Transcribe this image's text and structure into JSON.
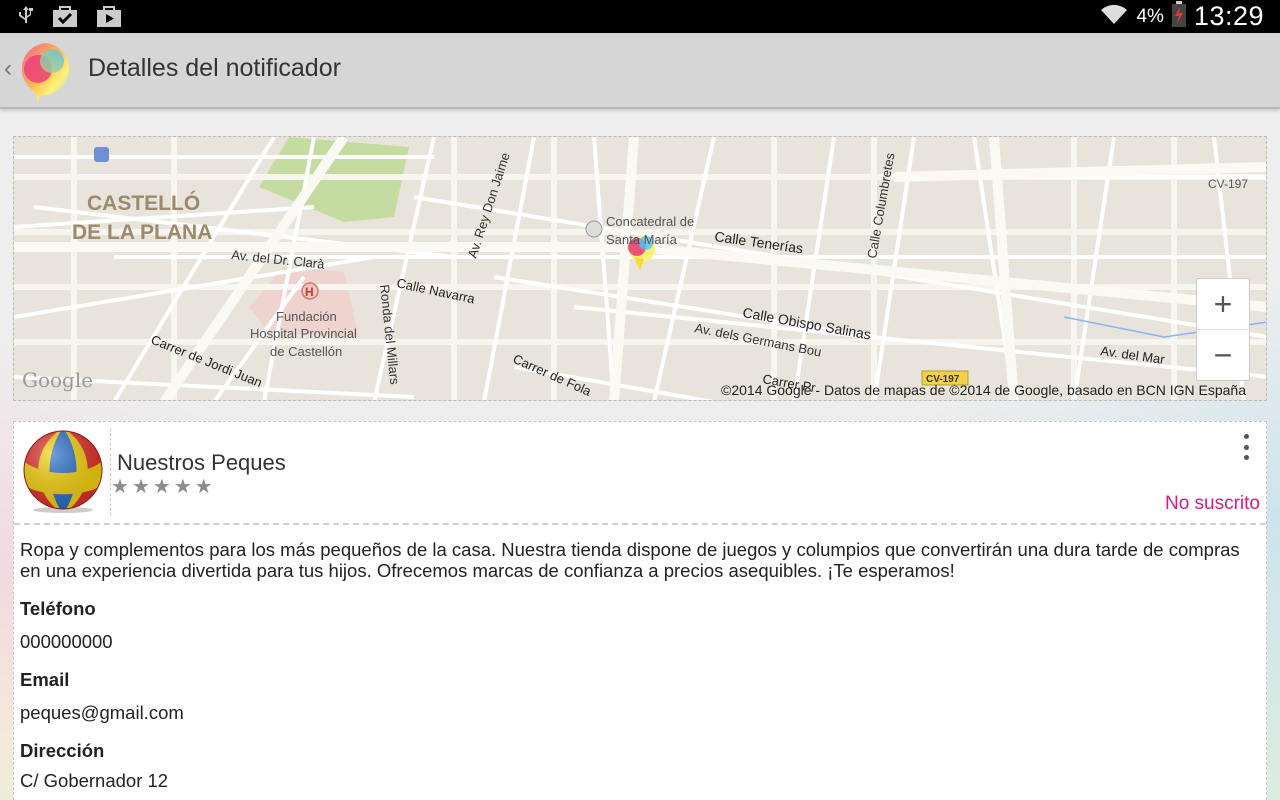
{
  "status_bar": {
    "battery_pct": "4%",
    "time": "13:29"
  },
  "action_bar": {
    "title": "Detalles del notificador"
  },
  "map": {
    "labels": {
      "city_line1": "CASTELLÓ",
      "city_line2": "DE LA PLANA",
      "concatedral_line1": "Concatedral de",
      "concatedral_line2": "Santa María",
      "calle_tenerias": "Calle Tenerías",
      "av_rey_don_jaime": "Av. Rey Don Jaime",
      "calle_columbretes": "Calle Columbretes",
      "av_dr_clara": "Av. del Dr. Clarà",
      "calle_navarra": "Calle Navarra",
      "fundacion_line1": "Fundación",
      "fundacion_line2": "Hospital Provincial",
      "fundacion_line3": "de Castellón",
      "ronda_millars": "Ronda del Millars",
      "carrer_jordi_juan": "Carrer de Jordi Juan",
      "carrer_fola": "Carrer de Fola",
      "calle_obispo_salinas": "Calle Obispo Salinas",
      "av_germans_bou": "Av. dels Germans Bou",
      "carrer_pr": "Carrer Pr",
      "av_del_mar": "Av. del Mar",
      "cv197_top": "CV-197",
      "cv197_shield": "CV-197"
    },
    "google_logo": "Google",
    "copyright": "©2014 Google - Datos de mapas de ©2014 de Google, basado en BCN IGN España",
    "zoom_in": "+",
    "zoom_out": "−"
  },
  "notifier": {
    "name": "Nuestros Peques",
    "rating_stars": 0,
    "rating_max": 5,
    "subscription_status": "No suscrito",
    "description": "Ropa y complementos para los más pequeños de la casa. Nuestra tienda dispone de juegos y columpios que convertirán una dura tarde de compras en una experiencia divertida para tus hijos. Ofrecemos marcas de confianza a precios asequibles. ¡Te esperamos!",
    "phone_label": "Teléfono",
    "phone_value": "000000000",
    "email_label": "Email",
    "email_value": "peques@gmail.com",
    "address_label": "Dirección",
    "address_value": "C/ Gobernador 12"
  },
  "colors": {
    "status_bar_bg": "#000000",
    "action_bar_bg": "#d6d6d6",
    "subscription_accent": "#d81b7a"
  }
}
